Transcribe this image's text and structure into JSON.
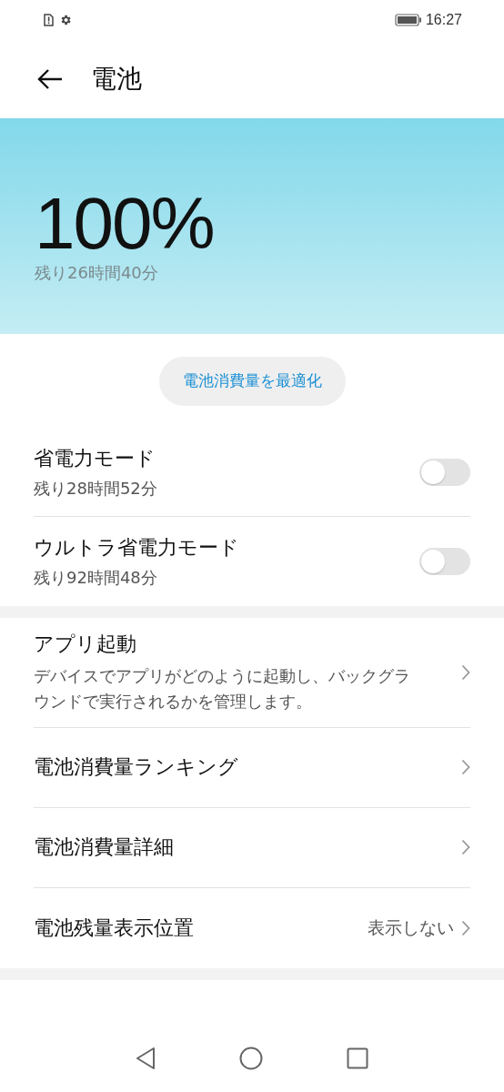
{
  "status_bar": {
    "time": "16:27"
  },
  "header": {
    "title": "電池"
  },
  "battery": {
    "percent": "100%",
    "remaining": "残り26時間40分"
  },
  "optimize_button": {
    "label": "電池消費量を最適化"
  },
  "modes": [
    {
      "title": "省電力モード",
      "subtitle": "残り28時間52分",
      "on": false
    },
    {
      "title": "ウルトラ省電力モード",
      "subtitle": "残り92時間48分",
      "on": false
    }
  ],
  "settings": [
    {
      "title": "アプリ起動",
      "description": "デバイスでアプリがどのように起動し、バックグラウンドで実行されるかを管理します。"
    },
    {
      "title": "電池消費量ランキング"
    },
    {
      "title": "電池消費量詳細"
    },
    {
      "title": "電池残量表示位置",
      "value": "表示しない"
    }
  ]
}
